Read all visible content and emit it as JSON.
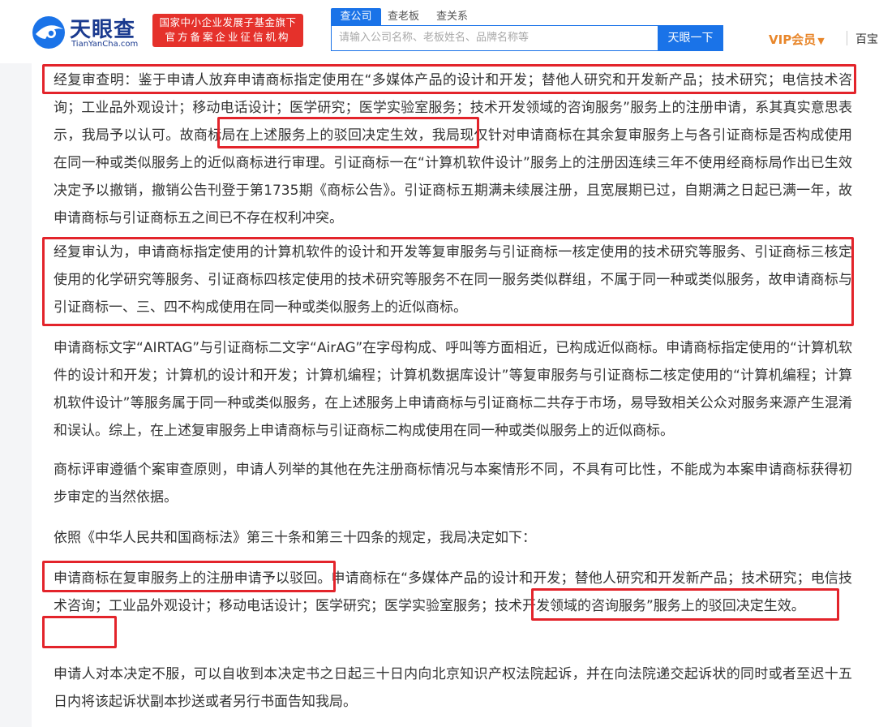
{
  "header": {
    "logo_text": "天眼查",
    "logo_sub": "TianYanCha.com",
    "badge_line1": "国家中小企业发展子基金旗下",
    "badge_line2": "官方备案企业征信机构",
    "tabs": [
      {
        "label": "查公司"
      },
      {
        "label": "查老板"
      },
      {
        "label": "查关系"
      }
    ],
    "search_placeholder": "请输入公司名称、老板姓名、品牌名称等",
    "search_button": "天眼一下",
    "vip_label": "VIP会员",
    "nav_more": "百宝"
  },
  "colors": {
    "brand_blue": "#1a73e8",
    "badge_red": "#e5312b",
    "highlight_red": "#e3242b",
    "vip_orange": "#e8862a"
  },
  "paragraphs": [
    "经复审查明：鉴于申请人放弃申请商标指定使用在“多媒体产品的设计和开发；替他人研究和开发新产品；技术研究；电信技术咨询；工业品外观设计；移动电话设计；医学研究；医学实验室服务；技术开发领域的咨询服务”服务上的注册申请，系其真实意思表示，我局予以认可。故商标局在上述服务上的驳回决定生效，我局现仅针对申请商标在其余复审服务上与各引证商标是否构成使用在同一种或类似服务上的近似商标进行审理。引证商标一在“计算机软件设计”服务上的注册因连续三年不使用经商标局作出已生效决定予以撤销，撤销公告刊登于第1735期《商标公告》。引证商标五期满未续展注册，且宽展期已过，自期满之日起已满一年，故申请商标与引证商标五之间已不存在权利冲突。",
    "经复审认为，申请商标指定使用的计算机软件的设计和开发等复审服务与引证商标一核定使用的技术研究等服务、引证商标三核定使用的化学研究等服务、引证商标四核定使用的技术研究等服务不在同一服务类似群组，不属于同一种或类似服务，故申请商标与引证商标一、三、四不构成使用在同一种或类似服务上的近似商标。",
    "申请商标文字“AIRTAG”与引证商标二文字“AirAG”在字母构成、呼叫等方面相近，已构成近似商标。申请商标指定使用的“计算机软件的设计和开发；计算机的设计和开发；计算机编程；计算机数据库设计”等复审服务与引证商标二核定使用的“计算机编程；计算机软件设计”等服务属于同一种或类似服务，在上述服务上申请商标与引证商标二共存于市场，易导致相关公众对服务来源产生混淆和误认。综上，在上述复审服务上申请商标与引证商标二构成使用在同一种或类似服务上的近似商标。",
    "商标评审遵循个案审查原则，申请人列举的其他在先注册商标情况与本案情形不同，不具有可比性，不能成为本案申请商标获得初步审定的当然依据。",
    "依照《中华人民共和国商标法》第三十条和第三十四条的规定，我局决定如下：",
    "申请商标在复审服务上的注册申请予以驳回。申请商标在“多媒体产品的设计和开发；替他人研究和开发新产品；技术研究；电信技术咨询；工业品外观设计；移动电话设计；医学研究；医学实验室服务；技术开发领域的咨询服务”服务上的驳回决定生效。",
    "申请人对本决定不服，可以自收到本决定书之日起三十日内向北京知识产权法院起诉，并在向法院递交起诉状的同时或者至迟十五日内将该起诉状副本抄送或者另行书面告知我局。"
  ]
}
